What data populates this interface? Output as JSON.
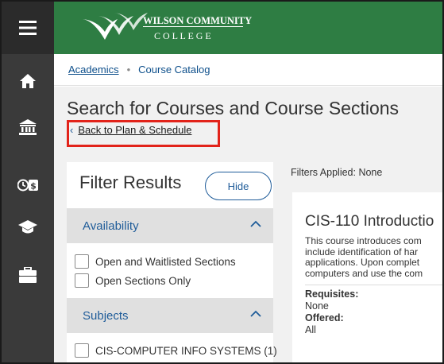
{
  "logo": {
    "line1": "WILSON COMMUNITY",
    "line2": "C O L L E G E"
  },
  "breadcrumb": {
    "link": "Academics",
    "separator": "•",
    "current": "Course Catalog"
  },
  "page": {
    "title": "Search for Courses and Course Sections",
    "back_link": "Back to Plan & Schedule"
  },
  "filter": {
    "title": "Filter Results",
    "hide_label": "Hide",
    "availability": {
      "label": "Availability",
      "options": [
        "Open and Waitlisted Sections",
        "Open Sections Only"
      ]
    },
    "subjects": {
      "label": "Subjects",
      "options": [
        "CIS-COMPUTER INFO SYSTEMS (1)"
      ]
    }
  },
  "results": {
    "filters_applied": "Filters Applied: None",
    "course": {
      "title": "CIS-110 Introductio",
      "description_lines": [
        "This course introduces com",
        "include identification of har",
        "applications. Upon complet",
        "computers and use the com"
      ],
      "requisites_label": "Requisites:",
      "requisites_value": "None",
      "offered_label": "Offered:",
      "offered_value": "All"
    }
  },
  "colors": {
    "header_green": "#2e7d43",
    "rail": "#3a3a3a",
    "link_blue": "#1f5c99",
    "highlight_red": "#e2231a"
  },
  "icons": [
    "menu-icon",
    "home-icon",
    "institution-icon",
    "clock-dollar-icon",
    "graduation-cap-icon",
    "briefcase-icon"
  ]
}
